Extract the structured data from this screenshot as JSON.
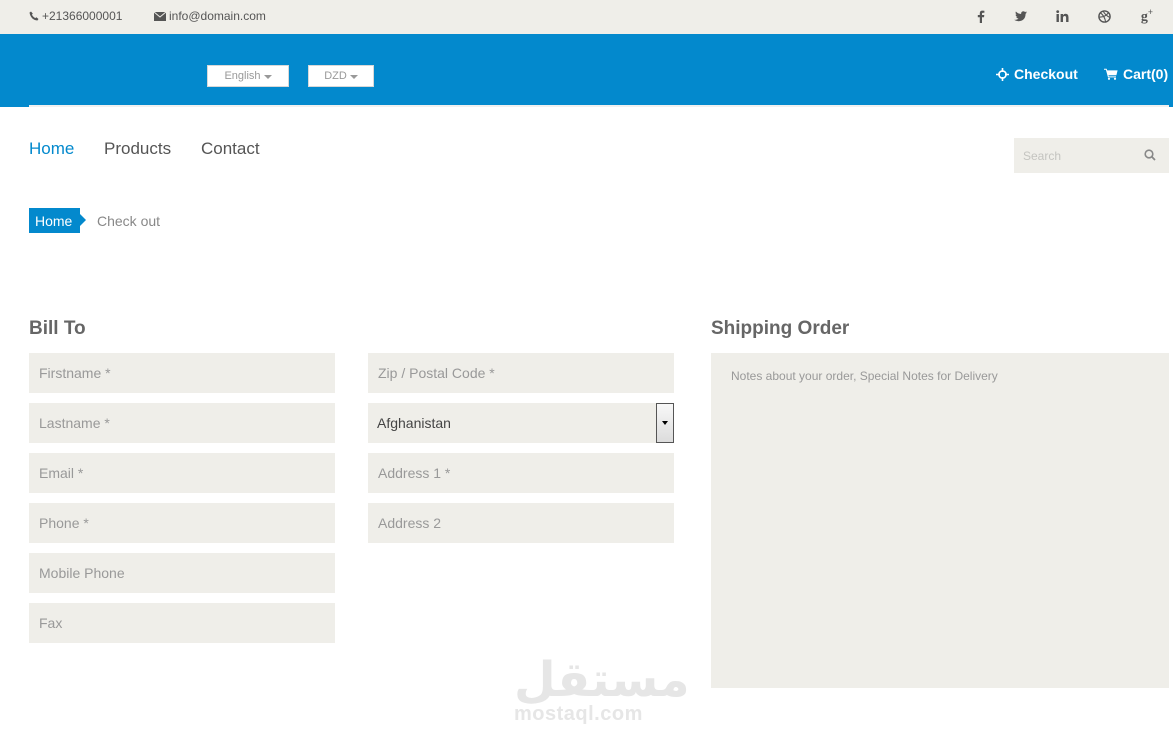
{
  "topbar": {
    "phone": "+21366000001",
    "email": "info@domain.com",
    "social": [
      {
        "name": "facebook-icon",
        "glyph": "f"
      },
      {
        "name": "twitter-icon",
        "glyph": "t"
      },
      {
        "name": "linkedin-icon",
        "glyph": "in"
      },
      {
        "name": "dribbble-icon",
        "glyph": "d"
      },
      {
        "name": "google-plus-icon",
        "glyph": "g+"
      }
    ]
  },
  "header": {
    "language": "English",
    "currency": "DZD",
    "checkout_label": "Checkout",
    "cart_label": "Cart(0)"
  },
  "nav": {
    "items": [
      "Home",
      "Products",
      "Contact"
    ],
    "search_placeholder": "Search"
  },
  "breadcrumb": {
    "home": "Home",
    "current": "Check out"
  },
  "bill_to": {
    "title": "Bill To",
    "firstname_placeholder": "Firstname *",
    "lastname_placeholder": "Lastname *",
    "email_placeholder": "Email *",
    "phone_placeholder": "Phone *",
    "mobile_placeholder": "Mobile Phone",
    "fax_placeholder": "Fax",
    "zip_placeholder": "Zip / Postal Code *",
    "country_value": "Afghanistan",
    "address1_placeholder": "Address 1 *",
    "address2_placeholder": "Address 2"
  },
  "shipping": {
    "title": "Shipping Order",
    "notes_placeholder": "Notes about your order, Special Notes for Delivery"
  },
  "watermark": {
    "arabic": "مستقل",
    "latin": "mostaql.com"
  },
  "colors": {
    "brand_blue": "#0389cd",
    "field_bg": "#efeee9"
  }
}
